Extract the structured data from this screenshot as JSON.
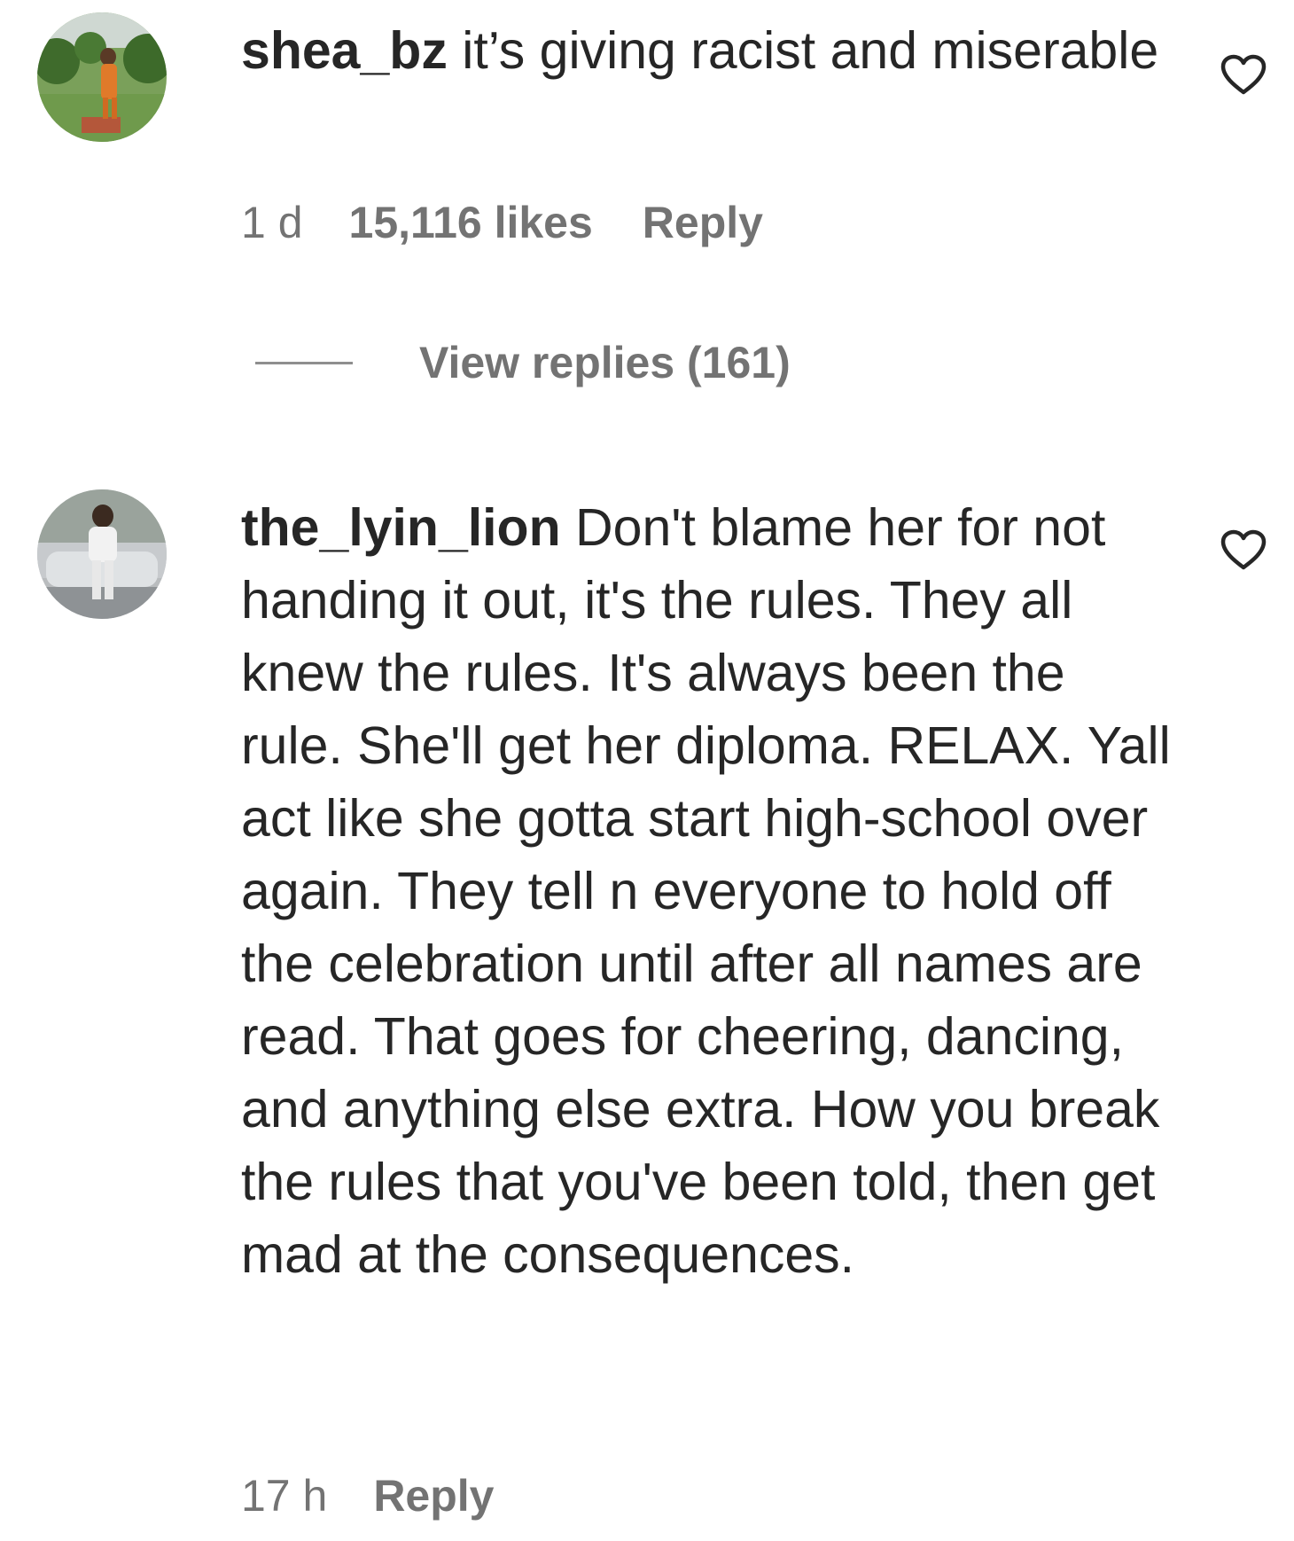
{
  "comments": [
    {
      "username": "shea_bz",
      "text": " it’s giving racist and miserable",
      "time": "1 d",
      "likes": "15,116 likes",
      "reply_label": "Reply",
      "like_icon": "heart-outline-icon",
      "view_replies": "View replies (161)"
    },
    {
      "username": "the_lyin_lion",
      "text": " Don't blame her for not handing it out, it's the rules. They all knew the rules. It's always been the rule. She'll get her diploma. RELAX. Yall act like she gotta start high-school over again. They tell n everyone to hold off the celebration until after all names are read. That goes for cheering, dancing, and anything else extra. How you break the rules that you've been told, then get mad at the consequences.",
      "time": "17 h",
      "reply_label": "Reply",
      "like_icon": "heart-outline-icon"
    }
  ]
}
